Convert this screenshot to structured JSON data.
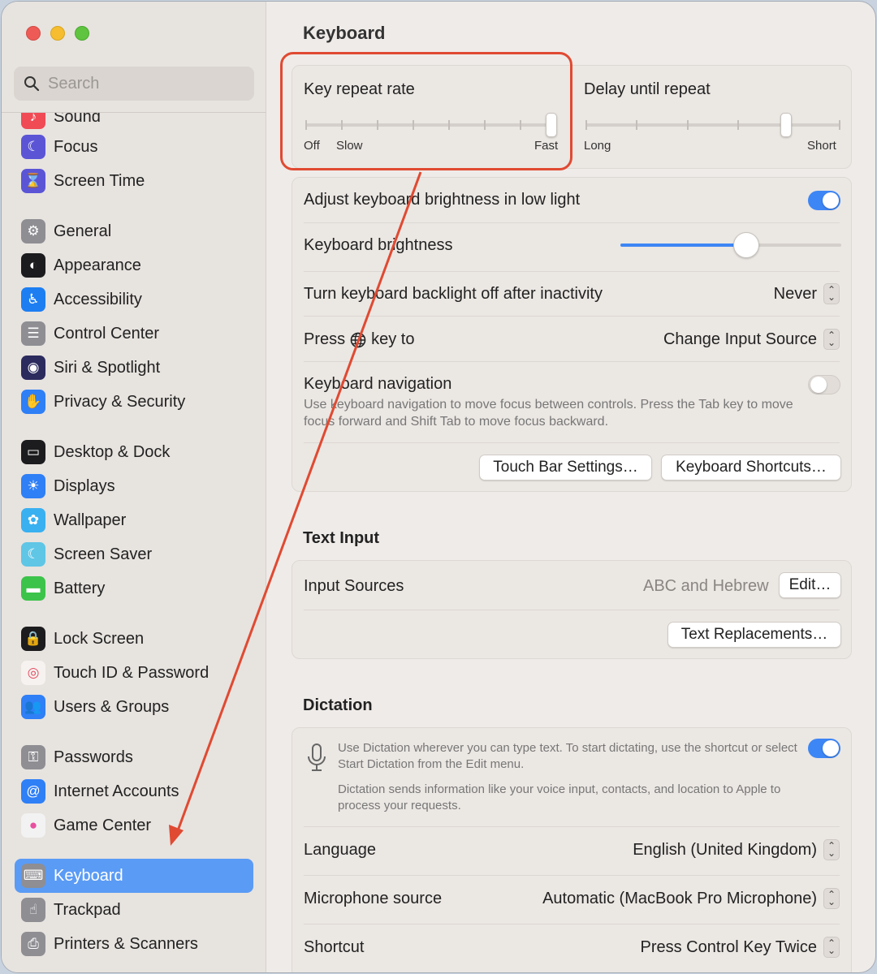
{
  "window": {
    "title": "Keyboard"
  },
  "search": {
    "placeholder": "Search"
  },
  "sidebar": {
    "items": [
      {
        "label": "Sound",
        "icon": "sound-icon",
        "color": "#f04a55"
      },
      {
        "label": "Focus",
        "icon": "moon-icon",
        "color": "#5b55d6"
      },
      {
        "label": "Screen Time",
        "icon": "hourglass-icon",
        "color": "#5b55d6"
      },
      {
        "label": "General",
        "icon": "gear-icon",
        "color": "#8e8e93"
      },
      {
        "label": "Appearance",
        "icon": "appearance-icon",
        "color": "#1c1c1e"
      },
      {
        "label": "Accessibility",
        "icon": "accessibility-icon",
        "color": "#1d7ef2"
      },
      {
        "label": "Control Center",
        "icon": "control-center-icon",
        "color": "#8e8e93"
      },
      {
        "label": "Siri & Spotlight",
        "icon": "siri-icon",
        "color": "#2b2b5e"
      },
      {
        "label": "Privacy & Security",
        "icon": "hand-icon",
        "color": "#2f7ff6"
      },
      {
        "label": "Desktop & Dock",
        "icon": "dock-icon",
        "color": "#1c1c1e"
      },
      {
        "label": "Displays",
        "icon": "sun-icon",
        "color": "#2f7ff6"
      },
      {
        "label": "Wallpaper",
        "icon": "flower-icon",
        "color": "#39b0f0"
      },
      {
        "label": "Screen Saver",
        "icon": "screen-saver-icon",
        "color": "#5fc6e6"
      },
      {
        "label": "Battery",
        "icon": "battery-icon",
        "color": "#3cc34a"
      },
      {
        "label": "Lock Screen",
        "icon": "lock-icon",
        "color": "#1c1c1e"
      },
      {
        "label": "Touch ID & Password",
        "icon": "fingerprint-icon",
        "color": "#f6f2f0"
      },
      {
        "label": "Users & Groups",
        "icon": "users-icon",
        "color": "#2f7ff6"
      },
      {
        "label": "Passwords",
        "icon": "key-icon",
        "color": "#8e8e93"
      },
      {
        "label": "Internet Accounts",
        "icon": "at-icon",
        "color": "#2f7ff6"
      },
      {
        "label": "Game Center",
        "icon": "game-center-icon",
        "color": "#f2f2f2"
      },
      {
        "label": "Keyboard",
        "icon": "keyboard-icon",
        "color": "#8e8e93",
        "selected": true
      },
      {
        "label": "Trackpad",
        "icon": "trackpad-icon",
        "color": "#8e8e93"
      },
      {
        "label": "Printers & Scanners",
        "icon": "printer-icon",
        "color": "#8e8e93"
      }
    ]
  },
  "repeat": {
    "key_repeat_label": "Key repeat rate",
    "key_repeat_off": "Off",
    "key_repeat_slow": "Slow",
    "key_repeat_fast": "Fast",
    "key_repeat_value": 1.0,
    "delay_label": "Delay until repeat",
    "delay_long": "Long",
    "delay_short": "Short",
    "delay_value": 0.8
  },
  "brightness": {
    "adjust_label": "Adjust keyboard brightness in low light",
    "adjust_on": true,
    "brightness_label": "Keyboard brightness",
    "brightness_value": 0.57,
    "backlight_label": "Turn keyboard backlight off after inactivity",
    "backlight_value": "Never",
    "press_label_a": "Press",
    "press_label_b": "key to",
    "press_value": "Change Input Source",
    "nav_label": "Keyboard navigation",
    "nav_desc": "Use keyboard navigation to move focus between controls. Press the Tab key to move focus forward and Shift Tab to move focus backward.",
    "nav_on": false,
    "touch_bar_button": "Touch Bar Settings…",
    "shortcuts_button": "Keyboard Shortcuts…"
  },
  "text_input": {
    "section_title": "Text Input",
    "sources_label": "Input Sources",
    "sources_value": "ABC and Hebrew",
    "edit_button": "Edit…",
    "replacements_button": "Text Replacements…"
  },
  "dictation": {
    "section_title": "Dictation",
    "desc1": "Use Dictation wherever you can type text. To start dictating, use the shortcut or select Start Dictation from the Edit menu.",
    "desc2": "Dictation sends information like your voice input, contacts, and location to Apple to process your requests.",
    "enabled": true,
    "language_label": "Language",
    "language_value": "English (United Kingdom)",
    "mic_label": "Microphone source",
    "mic_value": "Automatic (MacBook Pro Microphone)",
    "shortcut_label": "Shortcut",
    "shortcut_value": "Press Control Key Twice"
  },
  "colors": {
    "accent": "#3d86f5",
    "annotation": "#e04a32",
    "selection": "#5a9bf5"
  }
}
